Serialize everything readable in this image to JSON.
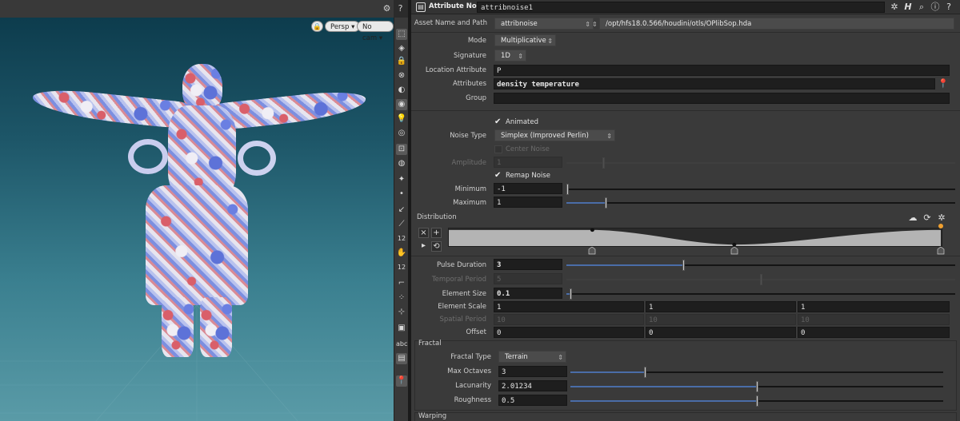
{
  "viewport": {
    "topbar_icons": [
      "display-options-icon",
      "help-icon"
    ],
    "persp_label": "Persp",
    "cam_label": "No cam",
    "shelf_tools": [
      "select-tool-icon",
      "view-tool-icon",
      "lock-icon",
      "camera-icon",
      "sphere-icon",
      "light-icon",
      "bulb-icon",
      "visibility-icon",
      "snap-icon",
      "ghost-icon",
      "point-icon",
      "normal-icon",
      "vector-icon",
      "number-icon",
      "grab-icon",
      "number2-icon",
      "edge-icon",
      "scatter-icon",
      "connect-icon",
      "frame-icon",
      "abc-icon",
      "image-icon",
      "pin-icon"
    ],
    "shelf_abc_label": "abc"
  },
  "header": {
    "node_type": "Attribute Noise",
    "node_name": "attribnoise1",
    "icons": [
      "gear-icon",
      "houdini-icon",
      "search-icon",
      "info-icon",
      "help-icon"
    ]
  },
  "asset": {
    "label": "Asset Name and Path",
    "name": "attribnoise",
    "path": "/opt/hfs18.0.566/houdini/otls/OPlibSop.hda"
  },
  "params": {
    "mode_label": "Mode",
    "mode_value": "Multiplicative",
    "signature_label": "Signature",
    "signature_value": "1D",
    "location_label": "Location Attribute",
    "location_value": "P",
    "attributes_label": "Attributes",
    "attributes_value": "density temperature",
    "group_label": "Group",
    "group_value": "",
    "animated_label": "Animated",
    "noise_type_label": "Noise Type",
    "noise_type_value": "Simplex (Improved Perlin)",
    "center_noise_label": "Center Noise",
    "amplitude_label": "Amplitude",
    "amplitude_value": "1",
    "remap_label": "Remap Noise",
    "minimum_label": "Minimum",
    "minimum_value": "-1",
    "maximum_label": "Maximum",
    "maximum_value": "1",
    "distribution_label": "Distribution",
    "pulse_label": "Pulse Duration",
    "pulse_value": "3",
    "temporal_label": "Temporal Period",
    "temporal_value": "5",
    "element_size_label": "Element Size",
    "element_size_value": "0.1",
    "element_scale_label": "Element Scale",
    "element_scale": [
      "1",
      "1",
      "1"
    ],
    "spatial_label": "Spatial Period",
    "spatial_period": [
      "10",
      "10",
      "10"
    ],
    "offset_label": "Offset",
    "offset": [
      "0",
      "0",
      "0"
    ],
    "fractal_label": "Fractal",
    "fractal_type_label": "Fractal Type",
    "fractal_type_value": "Terrain",
    "max_octaves_label": "Max Octaves",
    "max_octaves_value": "3",
    "lacunarity_label": "Lacunarity",
    "lacunarity_value": "2.01234",
    "roughness_label": "Roughness",
    "roughness_value": "0.5",
    "warping_label": "Warping"
  },
  "sliders": {
    "minimum": 0.0,
    "maximum": 0.1,
    "pulse": 0.3,
    "temporal": 0.5,
    "element_size": 0.01,
    "max_octaves": 0.2,
    "lacunarity": 0.5,
    "roughness": 0.5
  },
  "colors": {
    "accent_slider": "#4a6da8",
    "panel_bg": "#3a3a3a",
    "field_bg": "#1e1e1e",
    "scene_top": "#0d3c4d",
    "scene_bottom": "#5a9ba7",
    "ramp_fill": "#b4b4b4",
    "ramp_active_key": "#f0a030"
  }
}
